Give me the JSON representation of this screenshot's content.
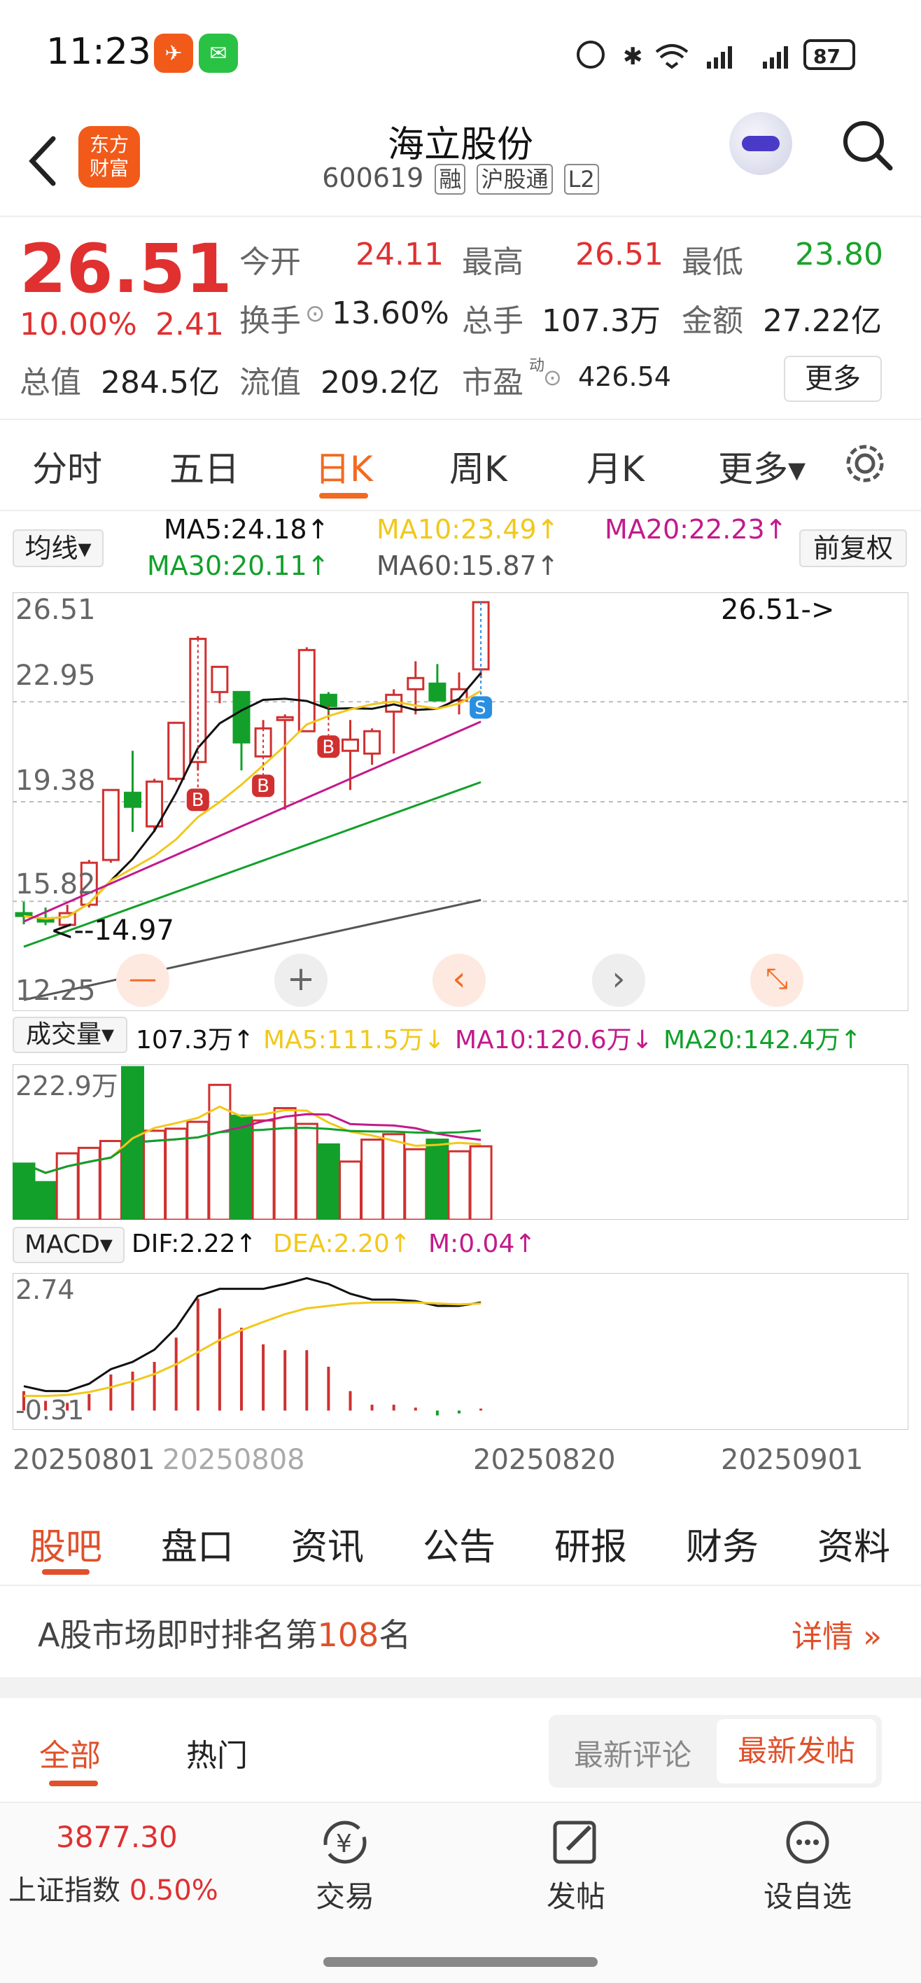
{
  "status_bar": {
    "time": "11:23",
    "battery": "87"
  },
  "header": {
    "back_icon": "chevron-left-icon",
    "app_logo_text": [
      "东方",
      "财富"
    ],
    "title": "海立股份",
    "code": "600619",
    "tags": [
      "融",
      "沪股通",
      "L2"
    ],
    "search_icon": "search-icon"
  },
  "quote": {
    "price": "26.51",
    "change_pct": "10.00%",
    "change_amt": "2.41",
    "fields": [
      {
        "label": "今开",
        "value": "24.11",
        "color": "#e03030"
      },
      {
        "label": "最高",
        "value": "26.51",
        "color": "#e03030"
      },
      {
        "label": "最低",
        "value": "23.80",
        "color": "#1aa32a"
      }
    ],
    "row2": [
      {
        "label": "换手",
        "value": "13.60%"
      },
      {
        "label": "总手",
        "value": "107.3万"
      },
      {
        "label": "金额",
        "value": "27.22亿"
      }
    ],
    "row3": [
      {
        "label": "总值",
        "value": "284.5亿"
      },
      {
        "label": "流值",
        "value": "209.2亿"
      },
      {
        "label": "市盈",
        "sup": "动",
        "value": "426.54"
      }
    ],
    "more_button": "更多"
  },
  "period_tabs": [
    {
      "label": "分时"
    },
    {
      "label": "五日"
    },
    {
      "label": "日K",
      "active": true
    },
    {
      "label": "周K"
    },
    {
      "label": "月K"
    },
    {
      "label": "更多▾"
    }
  ],
  "kline": {
    "ma_dropdown": "均线",
    "fq_button": "前复权",
    "ma_labels": {
      "ma5": "MA5:24.18↑",
      "ma10": "MA10:23.49↑",
      "ma20": "MA20:22.23↑",
      "ma30": "MA30:20.11↑",
      "ma60": "MA60:15.87↑"
    },
    "y_ticks": [
      "26.51",
      "22.95",
      "19.38",
      "15.82",
      "12.25"
    ],
    "max_annotation": "26.51->",
    "min_annotation": "<--14.97",
    "colors": {
      "up": "#d03030",
      "down": "#12a02a",
      "ma5": "#111111",
      "ma10": "#f2c81a",
      "ma20": "#c21a8c",
      "ma30": "#12a02a",
      "ma60": "#555555"
    },
    "trade_marks": [
      "B",
      "B",
      "B",
      "S"
    ],
    "zoom_controls": [
      "—",
      "+",
      "‹",
      "›",
      "⤡"
    ]
  },
  "volume": {
    "dropdown": "成交量",
    "value": "107.3万↑",
    "ma5": "MA5:111.5万↓",
    "ma10": "MA10:120.6万↓",
    "ma20": "MA20:142.4万↑",
    "max_tick": "222.9万"
  },
  "macd": {
    "dropdown": "MACD",
    "dif": "DIF:2.22↑",
    "dea": "DEA:2.20↑",
    "m": "M:0.04↑",
    "y_top": "2.74",
    "y_bottom": "-0.31"
  },
  "x_dates": [
    "20250801",
    "20250808",
    "20250820",
    "20250901"
  ],
  "chart_data": {
    "type": "candlestick",
    "x": [
      "20250801",
      "20250804",
      "20250805",
      "20250806",
      "20250807",
      "20250808",
      "20250811",
      "20250812",
      "20250813",
      "20250814",
      "20250815",
      "20250818",
      "20250819",
      "20250820",
      "20250821",
      "20250822",
      "20250825",
      "20250826",
      "20250827",
      "20250828",
      "20250829",
      "20250901"
    ],
    "open": [
      15.4,
      15.2,
      14.98,
      15.7,
      17.3,
      19.7,
      18.5,
      20.2,
      20.8,
      23.3,
      23.3,
      21.0,
      22.3,
      21.9,
      23.2,
      21.2,
      21.1,
      22.6,
      23.4,
      23.6,
      23.0,
      24.11
    ],
    "close": [
      15.3,
      15.1,
      15.4,
      17.2,
      19.8,
      19.2,
      20.1,
      22.2,
      25.2,
      24.2,
      21.5,
      22.0,
      22.4,
      24.8,
      22.8,
      21.6,
      21.9,
      23.2,
      23.8,
      23.0,
      23.4,
      26.51
    ],
    "high": [
      15.8,
      15.6,
      15.7,
      17.3,
      19.8,
      21.2,
      20.2,
      22.2,
      25.3,
      24.2,
      21.5,
      22.3,
      22.5,
      24.9,
      23.3,
      22.3,
      22.0,
      23.4,
      24.4,
      24.3,
      24.0,
      26.51
    ],
    "low": [
      15.0,
      14.97,
      14.97,
      15.6,
      17.2,
      18.3,
      18.3,
      20.1,
      20.5,
      22.9,
      20.5,
      21.0,
      19.1,
      21.9,
      22.4,
      19.8,
      20.7,
      21.1,
      22.5,
      23.0,
      22.5,
      23.8
    ],
    "volume": [
      82,
      55,
      97,
      105,
      115,
      222.9,
      130,
      133,
      143,
      197,
      152,
      145,
      163,
      140,
      110,
      85,
      117,
      125,
      103,
      117,
      100,
      107.3
    ],
    "ylim": [
      12.25,
      26.51
    ]
  }
}
